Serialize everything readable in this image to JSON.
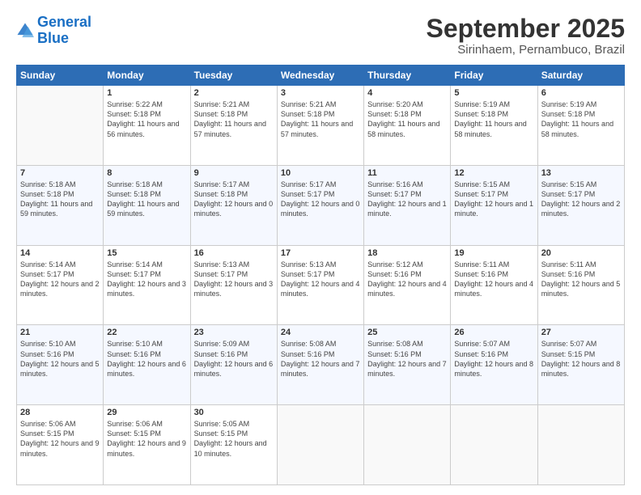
{
  "logo": {
    "line1": "General",
    "line2": "Blue"
  },
  "title": "September 2025",
  "subtitle": "Sirinhaem, Pernambuco, Brazil",
  "days_header": [
    "Sunday",
    "Monday",
    "Tuesday",
    "Wednesday",
    "Thursday",
    "Friday",
    "Saturday"
  ],
  "weeks": [
    [
      {
        "day": "",
        "sunrise": "",
        "sunset": "",
        "daylight": ""
      },
      {
        "day": "1",
        "sunrise": "Sunrise: 5:22 AM",
        "sunset": "Sunset: 5:18 PM",
        "daylight": "Daylight: 11 hours and 56 minutes."
      },
      {
        "day": "2",
        "sunrise": "Sunrise: 5:21 AM",
        "sunset": "Sunset: 5:18 PM",
        "daylight": "Daylight: 11 hours and 57 minutes."
      },
      {
        "day": "3",
        "sunrise": "Sunrise: 5:21 AM",
        "sunset": "Sunset: 5:18 PM",
        "daylight": "Daylight: 11 hours and 57 minutes."
      },
      {
        "day": "4",
        "sunrise": "Sunrise: 5:20 AM",
        "sunset": "Sunset: 5:18 PM",
        "daylight": "Daylight: 11 hours and 58 minutes."
      },
      {
        "day": "5",
        "sunrise": "Sunrise: 5:19 AM",
        "sunset": "Sunset: 5:18 PM",
        "daylight": "Daylight: 11 hours and 58 minutes."
      },
      {
        "day": "6",
        "sunrise": "Sunrise: 5:19 AM",
        "sunset": "Sunset: 5:18 PM",
        "daylight": "Daylight: 11 hours and 58 minutes."
      }
    ],
    [
      {
        "day": "7",
        "sunrise": "Sunrise: 5:18 AM",
        "sunset": "Sunset: 5:18 PM",
        "daylight": "Daylight: 11 hours and 59 minutes."
      },
      {
        "day": "8",
        "sunrise": "Sunrise: 5:18 AM",
        "sunset": "Sunset: 5:18 PM",
        "daylight": "Daylight: 11 hours and 59 minutes."
      },
      {
        "day": "9",
        "sunrise": "Sunrise: 5:17 AM",
        "sunset": "Sunset: 5:18 PM",
        "daylight": "Daylight: 12 hours and 0 minutes."
      },
      {
        "day": "10",
        "sunrise": "Sunrise: 5:17 AM",
        "sunset": "Sunset: 5:17 PM",
        "daylight": "Daylight: 12 hours and 0 minutes."
      },
      {
        "day": "11",
        "sunrise": "Sunrise: 5:16 AM",
        "sunset": "Sunset: 5:17 PM",
        "daylight": "Daylight: 12 hours and 1 minute."
      },
      {
        "day": "12",
        "sunrise": "Sunrise: 5:15 AM",
        "sunset": "Sunset: 5:17 PM",
        "daylight": "Daylight: 12 hours and 1 minute."
      },
      {
        "day": "13",
        "sunrise": "Sunrise: 5:15 AM",
        "sunset": "Sunset: 5:17 PM",
        "daylight": "Daylight: 12 hours and 2 minutes."
      }
    ],
    [
      {
        "day": "14",
        "sunrise": "Sunrise: 5:14 AM",
        "sunset": "Sunset: 5:17 PM",
        "daylight": "Daylight: 12 hours and 2 minutes."
      },
      {
        "day": "15",
        "sunrise": "Sunrise: 5:14 AM",
        "sunset": "Sunset: 5:17 PM",
        "daylight": "Daylight: 12 hours and 3 minutes."
      },
      {
        "day": "16",
        "sunrise": "Sunrise: 5:13 AM",
        "sunset": "Sunset: 5:17 PM",
        "daylight": "Daylight: 12 hours and 3 minutes."
      },
      {
        "day": "17",
        "sunrise": "Sunrise: 5:13 AM",
        "sunset": "Sunset: 5:17 PM",
        "daylight": "Daylight: 12 hours and 4 minutes."
      },
      {
        "day": "18",
        "sunrise": "Sunrise: 5:12 AM",
        "sunset": "Sunset: 5:16 PM",
        "daylight": "Daylight: 12 hours and 4 minutes."
      },
      {
        "day": "19",
        "sunrise": "Sunrise: 5:11 AM",
        "sunset": "Sunset: 5:16 PM",
        "daylight": "Daylight: 12 hours and 4 minutes."
      },
      {
        "day": "20",
        "sunrise": "Sunrise: 5:11 AM",
        "sunset": "Sunset: 5:16 PM",
        "daylight": "Daylight: 12 hours and 5 minutes."
      }
    ],
    [
      {
        "day": "21",
        "sunrise": "Sunrise: 5:10 AM",
        "sunset": "Sunset: 5:16 PM",
        "daylight": "Daylight: 12 hours and 5 minutes."
      },
      {
        "day": "22",
        "sunrise": "Sunrise: 5:10 AM",
        "sunset": "Sunset: 5:16 PM",
        "daylight": "Daylight: 12 hours and 6 minutes."
      },
      {
        "day": "23",
        "sunrise": "Sunrise: 5:09 AM",
        "sunset": "Sunset: 5:16 PM",
        "daylight": "Daylight: 12 hours and 6 minutes."
      },
      {
        "day": "24",
        "sunrise": "Sunrise: 5:08 AM",
        "sunset": "Sunset: 5:16 PM",
        "daylight": "Daylight: 12 hours and 7 minutes."
      },
      {
        "day": "25",
        "sunrise": "Sunrise: 5:08 AM",
        "sunset": "Sunset: 5:16 PM",
        "daylight": "Daylight: 12 hours and 7 minutes."
      },
      {
        "day": "26",
        "sunrise": "Sunrise: 5:07 AM",
        "sunset": "Sunset: 5:16 PM",
        "daylight": "Daylight: 12 hours and 8 minutes."
      },
      {
        "day": "27",
        "sunrise": "Sunrise: 5:07 AM",
        "sunset": "Sunset: 5:15 PM",
        "daylight": "Daylight: 12 hours and 8 minutes."
      }
    ],
    [
      {
        "day": "28",
        "sunrise": "Sunrise: 5:06 AM",
        "sunset": "Sunset: 5:15 PM",
        "daylight": "Daylight: 12 hours and 9 minutes."
      },
      {
        "day": "29",
        "sunrise": "Sunrise: 5:06 AM",
        "sunset": "Sunset: 5:15 PM",
        "daylight": "Daylight: 12 hours and 9 minutes."
      },
      {
        "day": "30",
        "sunrise": "Sunrise: 5:05 AM",
        "sunset": "Sunset: 5:15 PM",
        "daylight": "Daylight: 12 hours and 10 minutes."
      },
      {
        "day": "",
        "sunrise": "",
        "sunset": "",
        "daylight": ""
      },
      {
        "day": "",
        "sunrise": "",
        "sunset": "",
        "daylight": ""
      },
      {
        "day": "",
        "sunrise": "",
        "sunset": "",
        "daylight": ""
      },
      {
        "day": "",
        "sunrise": "",
        "sunset": "",
        "daylight": ""
      }
    ]
  ]
}
